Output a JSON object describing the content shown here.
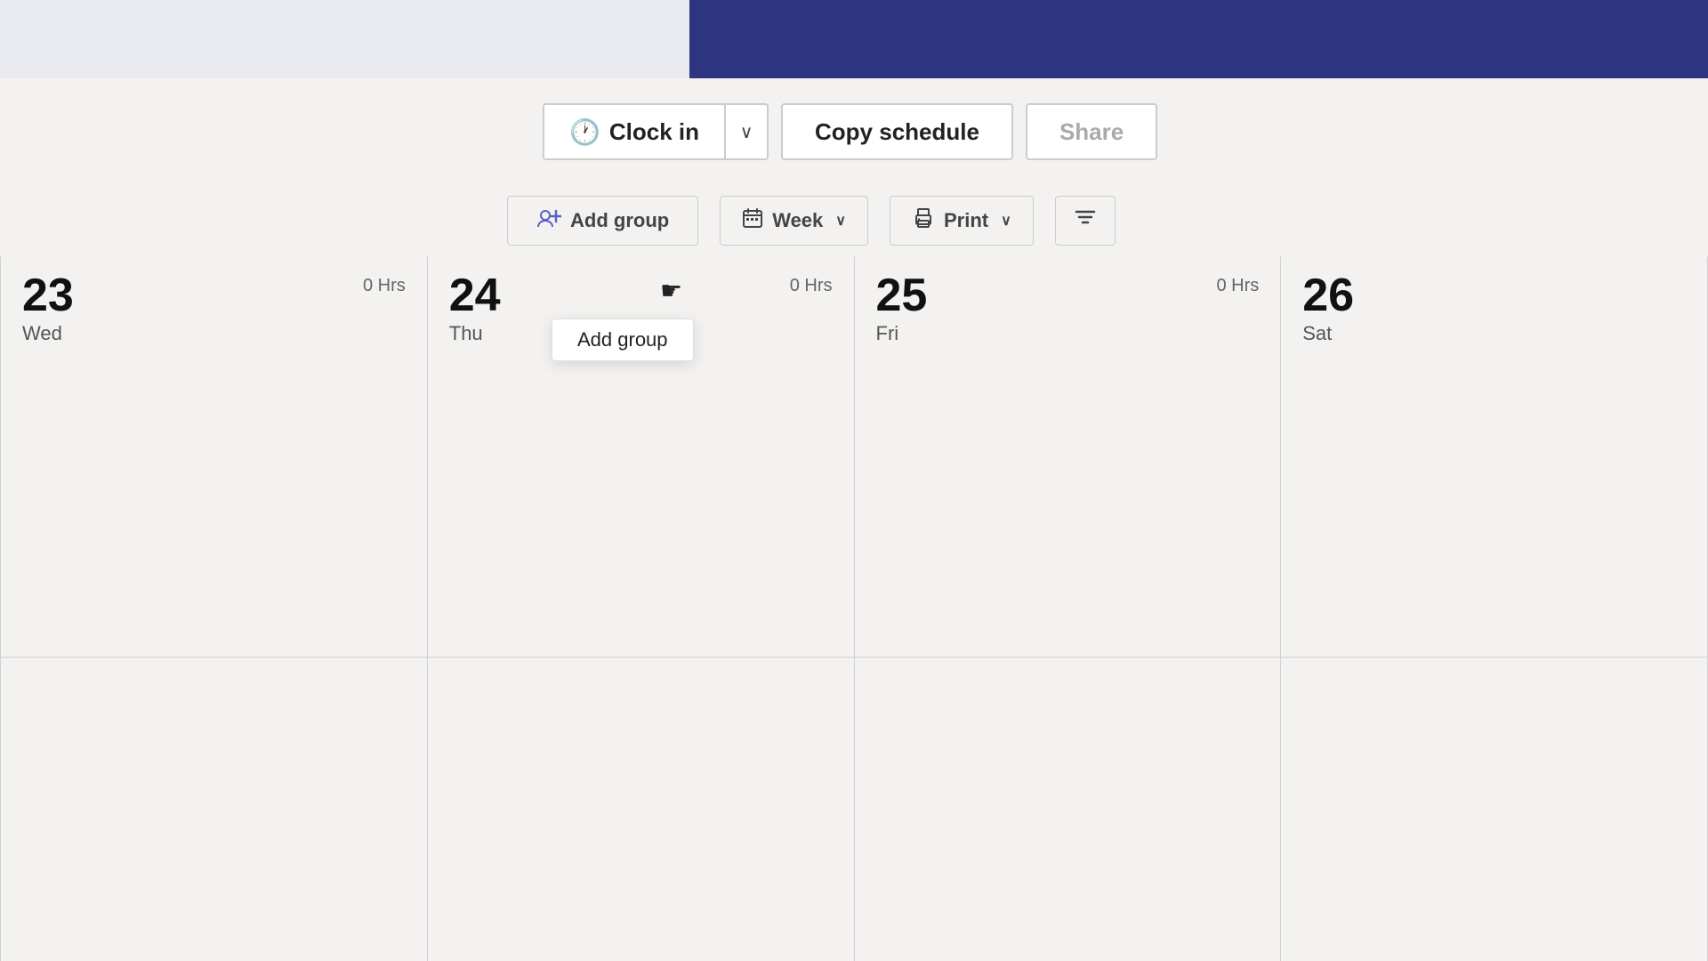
{
  "header": {
    "left_bg": "#e8eaf0",
    "right_bg": "#2d3580"
  },
  "toolbar": {
    "clock_in_label": "Clock in",
    "clock_in_icon": "🕐",
    "dropdown_arrow": "∨",
    "copy_schedule_label": "Copy schedule",
    "share_label": "Share"
  },
  "toolbar2": {
    "add_group_label": "Add group",
    "add_group_icon": "👥",
    "week_label": "Week",
    "week_icon": "📅",
    "week_arrow": "∨",
    "print_label": "Print",
    "print_arrow": "∨",
    "filter_icon": "⧖"
  },
  "dropdown": {
    "add_group_item": "Add group"
  },
  "days": [
    {
      "number": "23",
      "name": "Wed",
      "hours": "0 Hrs"
    },
    {
      "number": "24",
      "name": "Thu",
      "hours": "0 Hrs"
    },
    {
      "number": "25",
      "name": "Fri",
      "hours": "0 Hrs"
    },
    {
      "number": "26",
      "name": "Sat",
      "hours": ""
    }
  ]
}
